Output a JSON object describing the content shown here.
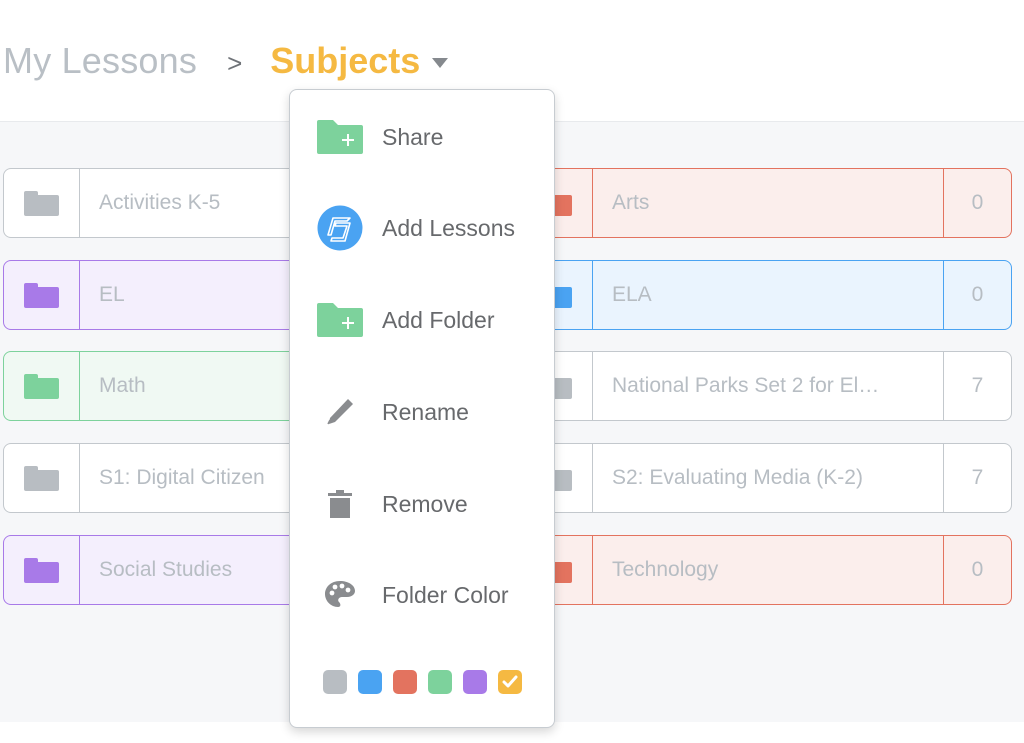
{
  "breadcrumb": {
    "root": "My Lessons",
    "separator": ">",
    "current": "Subjects",
    "current_color": "#f5b942"
  },
  "folders": {
    "left": [
      {
        "name": "Activities K-5",
        "color": "gray"
      },
      {
        "name": "EL",
        "color": "purple"
      },
      {
        "name": "Math",
        "color": "green"
      },
      {
        "name": "S1: Digital Citizen",
        "color": "gray"
      },
      {
        "name": "Social Studies",
        "color": "purple"
      }
    ],
    "right": [
      {
        "name": "Arts",
        "count": "0",
        "color": "red"
      },
      {
        "name": "ELA",
        "count": "0",
        "color": "blue"
      },
      {
        "name": "National Parks Set 2 for El…",
        "count": "7",
        "color": "gray"
      },
      {
        "name": "S2: Evaluating Media (K-2)",
        "count": "7",
        "color": "gray"
      },
      {
        "name": "Technology",
        "count": "0",
        "color": "red"
      }
    ]
  },
  "colors": {
    "gray": "#b8bdc2",
    "blue": "#4aa3f2",
    "red": "#e3735f",
    "green": "#7dd29c",
    "purple": "#a87ae8",
    "yellow": "#f5b942"
  },
  "context_menu": {
    "items": [
      {
        "label": "Share",
        "icon": "folder-plus-icon"
      },
      {
        "label": "Add Lessons",
        "icon": "nearpod-logo-icon"
      },
      {
        "label": "Add Folder",
        "icon": "folder-plus-icon"
      },
      {
        "label": "Rename",
        "icon": "pencil-icon"
      },
      {
        "label": "Remove",
        "icon": "trash-icon"
      },
      {
        "label": "Folder Color",
        "icon": "palette-icon"
      }
    ],
    "swatches": [
      {
        "name": "gray",
        "color": "#b8bdc2",
        "selected": false
      },
      {
        "name": "blue",
        "color": "#4aa3f2",
        "selected": false
      },
      {
        "name": "red",
        "color": "#e3735f",
        "selected": false
      },
      {
        "name": "green",
        "color": "#7dd29c",
        "selected": false
      },
      {
        "name": "purple",
        "color": "#a87ae8",
        "selected": false
      },
      {
        "name": "yellow",
        "color": "#f5b942",
        "selected": true
      }
    ]
  }
}
